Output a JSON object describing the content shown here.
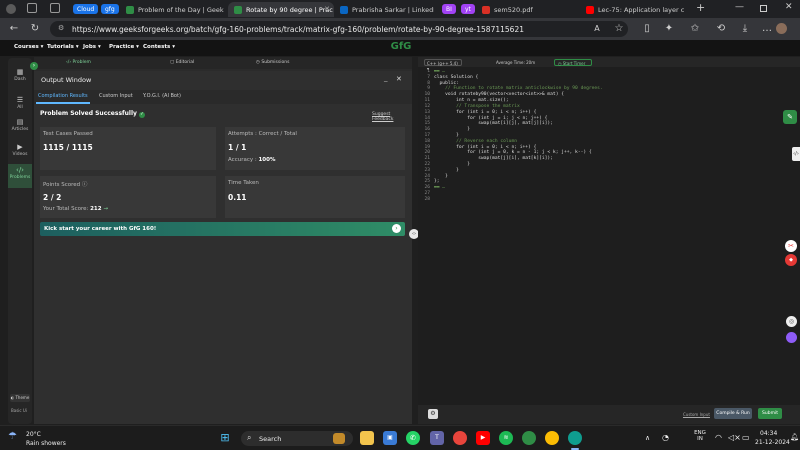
{
  "tabs": [
    {
      "label": "Cloud",
      "type": "pill",
      "color": "#1a73e8"
    },
    {
      "label": "gfg",
      "type": "pill",
      "color": "#1a73e8"
    },
    {
      "label": "Problem of the Day | Geek"
    },
    {
      "label": "Rotate by 90 degree | Prac",
      "active": true
    },
    {
      "label": "Prabrisha Sarkar | LinkedIn"
    },
    {
      "label": "BI",
      "type": "pill",
      "color": "#a142f4"
    },
    {
      "label": "yt",
      "type": "pill",
      "color": "#a142f4"
    },
    {
      "label": "sem520.pdf"
    },
    {
      "label": "Lec-75: Application layer c"
    }
  ],
  "address": {
    "url": "https://www.geeksforgeeks.org/batch/gfg-160-problems/track/matrix-gfg-160/problem/rotate-by-90-degree-1587115621"
  },
  "gfg_header": {
    "menus": [
      "Courses",
      "Tutorials",
      "Jobs",
      "Practice",
      "Contests"
    ],
    "logo": "GfG"
  },
  "sidebar": {
    "items": [
      {
        "label": "Dash",
        "icon": "grid-icon"
      },
      {
        "label": "All",
        "icon": "list-icon"
      },
      {
        "label": "Articles",
        "icon": "article-icon"
      },
      {
        "label": "Videos",
        "icon": "video-icon"
      },
      {
        "label": "Problems",
        "icon": "code-icon",
        "active": true
      }
    ],
    "theme_label": "Theme",
    "footer_label": "Basic Ui"
  },
  "problem_tabs": [
    "Problem",
    "Editorial",
    "Submissions"
  ],
  "output": {
    "title": "Output Window",
    "tabs": [
      "Compilation Results",
      "Custom Input",
      "Y.O.G.I. (AI Bot)"
    ],
    "status": "Problem Solved Successfully",
    "feedback": "Suggest Feedback",
    "test_cases_label": "Test Cases Passed",
    "test_cases_value": "1115 / 1115",
    "attempts_label": "Attempts : Correct / Total",
    "attempts_value": "1 / 1",
    "accuracy_label": "Accuracy :",
    "accuracy_value": "100%",
    "points_label": "Points Scored",
    "points_value": "2 / 2",
    "total_score_label": "Your Total Score:",
    "total_score_value": "212",
    "time_label": "Time Taken",
    "time_value": "0.11",
    "banner": "Kick start your career with GfG 160!"
  },
  "editor": {
    "language": "C++ (g++ 5.4)",
    "avg_time": "Average Time: 20m",
    "timer_label": "Start Timer",
    "line_numbers": [
      "1",
      "7",
      "8",
      "9",
      "10",
      "11",
      "12",
      "13",
      "14",
      "15",
      "16",
      "17",
      "18",
      "19",
      "20",
      "21",
      "22",
      "23",
      "24",
      "25",
      "26",
      "27",
      "28"
    ],
    "code_lines": [
      "▬▬ …",
      "",
      "class Solution {",
      "  public:",
      "    // Function to rotate matrix anticlockwise by 90 degrees.",
      "    void rotateby90(vector<vector<int>>& mat) {",
      "        int n = mat.size();",
      "        // Transpose the matrix",
      "        for (int i = 0; i < n; i++) {",
      "            for (int j = i; j < n; j++) {",
      "                swap(mat[i][j], mat[j][i]);",
      "            }",
      "        }",
      "        // Reverse each column",
      "        for (int i = 0; i < n; i++) {",
      "            for (int j = 0, k = n - 1; j < k; j++, k--) {",
      "                swap(mat[j][i], mat[k][i]);",
      "            }",
      "        }",
      "    }",
      "};",
      "",
      "▬▬ …"
    ],
    "contest_input": "Custom Input",
    "compile_label": "Compile & Run",
    "submit_label": "Submit"
  },
  "taskbar": {
    "weather_temp": "20°C",
    "weather_desc": "Rain showers",
    "search_placeholder": "Search",
    "lang_top": "ENG",
    "lang_bottom": "IN",
    "time": "04:34",
    "date": "21-12-2024"
  }
}
